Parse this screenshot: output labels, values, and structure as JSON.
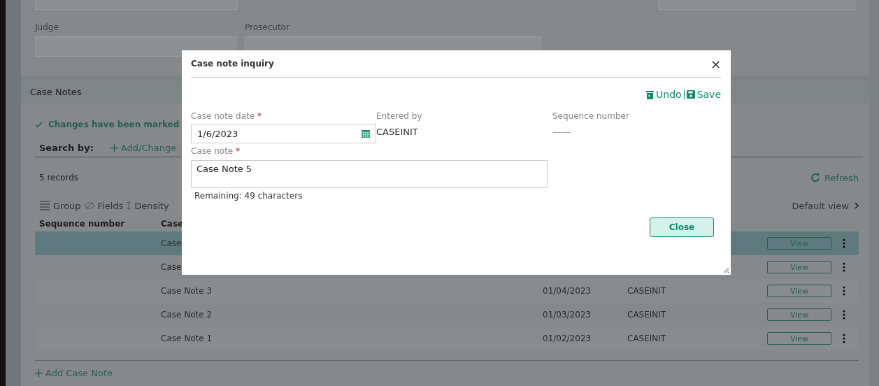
{
  "case_fields": [
    {
      "label": "Judge"
    },
    {
      "label": "Prosecutor"
    }
  ],
  "case_notes": {
    "title": "Case Notes",
    "message": "Changes have been marked",
    "search_by": "Search by:",
    "add_change": "Add/Change",
    "record_count": "5 records",
    "refresh": "Refresh",
    "toolbar": [
      "Group",
      "Fields",
      "Density"
    ],
    "default_view": "Default view",
    "columns": [
      "Sequence number",
      "Case"
    ],
    "rows": [
      {
        "selected": true,
        "note": "Case",
        "action": "View"
      },
      {
        "selected": false,
        "note": "Case",
        "action": "View"
      },
      {
        "selected": false,
        "note": "Case Note 3",
        "date": "01/04/2023",
        "entered_by": "CASEINIT",
        "action": "View"
      },
      {
        "selected": false,
        "note": "Case Note 2",
        "date": "01/03/2023",
        "entered_by": "CASEINIT",
        "action": "View"
      },
      {
        "selected": false,
        "note": "Case Note 1",
        "date": "01/02/2023",
        "entered_by": "CASEINIT",
        "action": "View"
      }
    ],
    "add_link": "Add Case Note"
  },
  "dialog": {
    "title": "Case note inquiry",
    "close_icon": "×",
    "undo": "Undo",
    "save": "Save",
    "date_label": "Case note date",
    "date_required": "*",
    "note_required": "*",
    "date_value": "1/6/2023",
    "entered_by_label": "Entered by",
    "entered_by_value": "CASEINIT",
    "sequence_label": "Sequence number",
    "sequence_value": "——",
    "note_label": "Case note",
    "note_value": "Case Note 5",
    "remaining": "Remaining: 49 characters",
    "close_button": "Close"
  }
}
